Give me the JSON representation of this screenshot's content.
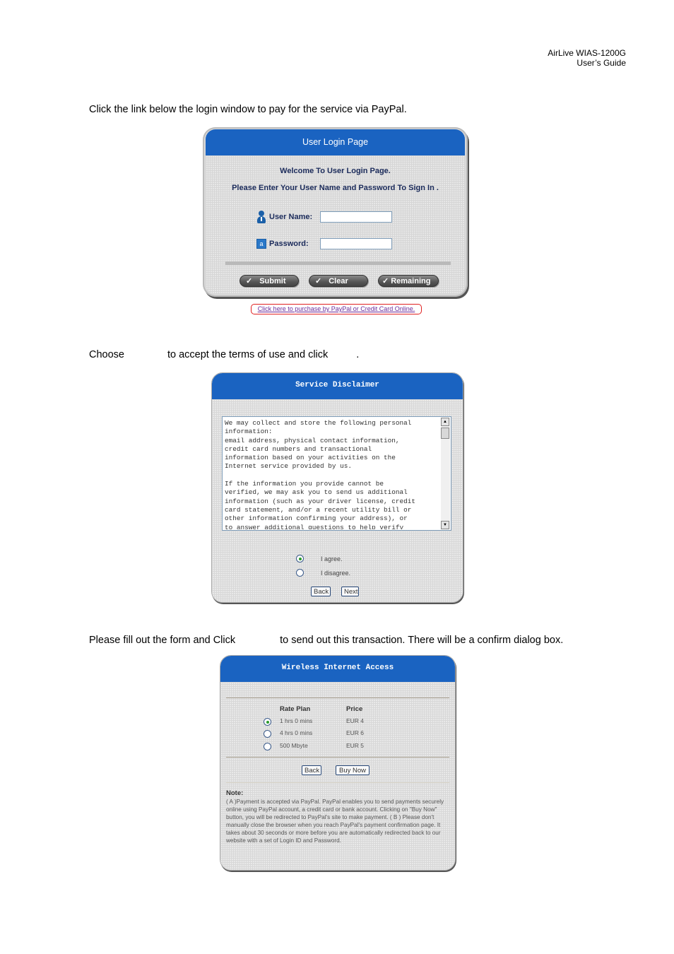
{
  "header": {
    "product": "AirLive  WIAS-1200G",
    "doc": "User’s  Guide"
  },
  "instructions": {
    "step1": "Click the link below the login window to pay for the service via PayPal.",
    "step2_before": "Choose",
    "step2_middle": "to accept the terms of use and click",
    "step2_after": ".",
    "step3_before": "Please fill out the form and Click",
    "step3_after": "to send out this transaction. There will be a confirm dialog box."
  },
  "login": {
    "title": "User Login Page",
    "welcome": "Welcome To User Login Page.",
    "instruction": "Please Enter Your User Name and Password To Sign In .",
    "username_label": "User Name:",
    "username_value": "",
    "password_label": "Password:",
    "password_value": "",
    "password_icon_glyph": "a",
    "check_glyph": "✓",
    "buttons": {
      "submit": "Submit",
      "clear": "Clear",
      "remaining": "Remaining"
    },
    "paypal_link": "Click here to purchase by PayPal or Credit Card Online."
  },
  "disclaimer": {
    "title": "Service Disclaimer",
    "text_lines": [
      "We may collect and store the following personal",
      "information:",
      "email address, physical contact information,",
      "credit card numbers and transactional",
      "information based on your activities on the",
      "Internet service provided by us.",
      "",
      "If the information you provide cannot be",
      "verified, we may ask you to send us additional",
      "information (such as your driver license, credit",
      "card statement, and/or a recent utility bill or",
      "other information confirming your address), or",
      "to answer additional questions to help verify"
    ],
    "scroll_up_glyph": "▲",
    "scroll_down_glyph": "▼",
    "options": [
      {
        "label": "I agree.",
        "checked": true
      },
      {
        "label": "I disagree.",
        "checked": false
      }
    ],
    "back_label": "Back",
    "next_label": "Next"
  },
  "wireless": {
    "title": "Wireless Internet Access",
    "columns": [
      "Rate Plan",
      "Price"
    ],
    "plans": [
      {
        "plan": "1 hrs 0 mins",
        "price": "EUR 4",
        "checked": true
      },
      {
        "plan": "4 hrs 0 mins",
        "price": "EUR 6",
        "checked": false
      },
      {
        "plan": "500 Mbyte",
        "price": "EUR 5",
        "checked": false
      }
    ],
    "back_label": "Back",
    "buy_label": "Buy Now",
    "note_title": "Note:",
    "note_text": "( A )Payment is accepted via PayPal. PayPal enables you to send payments securely online using PayPal account, a credit card or bank account. Clicking on \"Buy Now\" button, you will be redirected to PayPal's site to make payment. ( B ) Please don't manually close the browser when you reach PayPal's payment confirmation page. It takes about 30 seconds or more before you are automatically redirected back to our website with a set of Login ID and Password."
  },
  "colors": {
    "titlebar_blue": "#1a63c1",
    "label_navy": "#1a2a5a",
    "link_purple": "#6a2a9a",
    "highlight_red": "#e02020",
    "radio_green": "#2a9a2a"
  }
}
